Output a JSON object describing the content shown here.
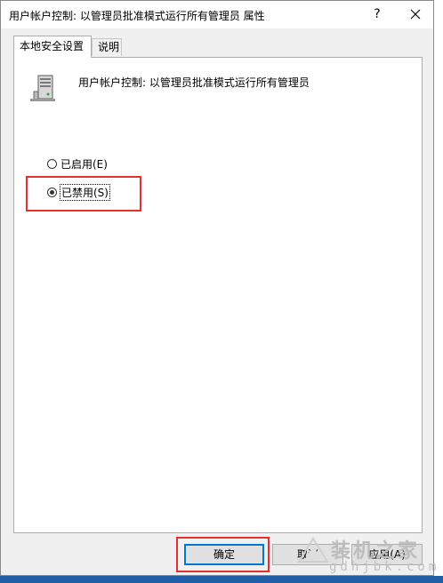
{
  "window": {
    "title": "用户帐户控制: 以管理员批准模式运行所有管理员 属性",
    "help_label": "?",
    "close_icon": "close-icon"
  },
  "tabs": [
    {
      "label": "本地安全设置",
      "active": true
    },
    {
      "label": "说明",
      "active": false
    }
  ],
  "policy": {
    "icon": "server-icon",
    "title": "用户帐户控制: 以管理员批准模式运行所有管理员"
  },
  "options": [
    {
      "label": "已启用(E)",
      "checked": false
    },
    {
      "label": "已禁用(S)",
      "checked": true
    }
  ],
  "buttons": {
    "ok": "确定",
    "cancel": "取消",
    "apply": "应用(A)"
  },
  "watermark": {
    "main": "装机之家",
    "sub": "gdhjbk.com"
  },
  "colors": {
    "highlight": "#e53030",
    "default_button_border": "#0078d7",
    "taskbar": "#1f5fa8"
  }
}
